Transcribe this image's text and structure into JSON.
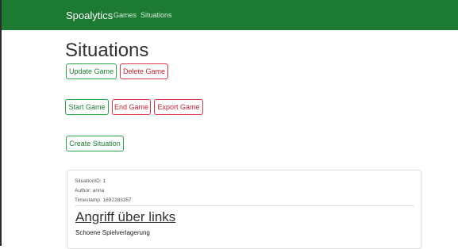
{
  "navbar": {
    "brand": "Spoalytics",
    "links": [
      "Games",
      "Situations"
    ],
    "color": "#1c7a33"
  },
  "page": {
    "title": "Situations"
  },
  "game_actions": {
    "update": "Update Game",
    "delete": "Delete Game"
  },
  "game_controls": {
    "start": "Start Game",
    "end": "End Game",
    "export": "Export Game"
  },
  "situation_actions": {
    "create": "Create Situation"
  },
  "situations": [
    {
      "id_label": "SituationID: 1",
      "author_label": "Author: anna",
      "timestamp_label": "Timestamp: 1692283357",
      "title": "Angriff über links",
      "description": "Schoene Spielverlagerung"
    }
  ],
  "colors": {
    "success": "#28a745",
    "danger": "#dc3545"
  }
}
